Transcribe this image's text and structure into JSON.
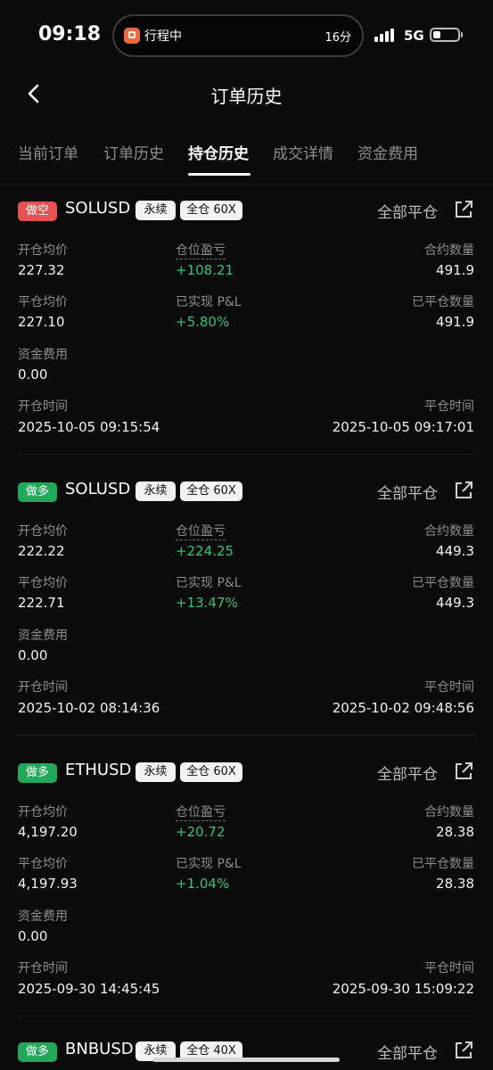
{
  "status_bar": {
    "time": "09:18",
    "live_activity": {
      "label": "行程中",
      "eta": "16分"
    },
    "network": "5G"
  },
  "header": {
    "title": "订单历史"
  },
  "tabs": [
    {
      "label": "当前订单"
    },
    {
      "label": "订单历史"
    },
    {
      "label": "持仓历史"
    },
    {
      "label": "成交详情"
    },
    {
      "label": "资金费用"
    }
  ],
  "active_tab": "持仓历史",
  "labels": {
    "close_all": "全部平仓",
    "avg_open_price": "开仓均价",
    "position_pnl": "仓位盈亏",
    "contract_qty": "合约数量",
    "avg_close_price": "平仓均价",
    "realized_pnl": "已实现 P&L",
    "closed_qty": "已平仓数量",
    "funding_fee": "资金费用",
    "open_time": "开仓时间",
    "close_time": "平仓时间"
  },
  "positions": [
    {
      "side": "做空",
      "symbol": "SOLUSD",
      "type": "永续",
      "margin": "全仓 60X",
      "avg_open_price": "227.32",
      "position_pnl": "+108.21",
      "contract_qty": "491.9",
      "avg_close_price": "227.10",
      "realized_pnl": "+5.80%",
      "closed_qty": "491.9",
      "funding_fee": "0.00",
      "open_time": "2025-10-05 09:15:54",
      "close_time": "2025-10-05 09:17:01"
    },
    {
      "side": "做多",
      "symbol": "SOLUSD",
      "type": "永续",
      "margin": "全仓 60X",
      "avg_open_price": "222.22",
      "position_pnl": "+224.25",
      "contract_qty": "449.3",
      "avg_close_price": "222.71",
      "realized_pnl": "+13.47%",
      "closed_qty": "449.3",
      "funding_fee": "0.00",
      "open_time": "2025-10-02 08:14:36",
      "close_time": "2025-10-02 09:48:56"
    },
    {
      "side": "做多",
      "symbol": "ETHUSD",
      "type": "永续",
      "margin": "全仓 60X",
      "avg_open_price": "4,197.20",
      "position_pnl": "+20.72",
      "contract_qty": "28.38",
      "avg_close_price": "4,197.93",
      "realized_pnl": "+1.04%",
      "closed_qty": "28.38",
      "funding_fee": "0.00",
      "open_time": "2025-09-30 14:45:45",
      "close_time": "2025-09-30 15:09:22"
    },
    {
      "side": "做多",
      "symbol": "BNBUSD",
      "type": "永续",
      "margin": "全仓 40X"
    }
  ],
  "colors": {
    "background": "#0b0b0b",
    "short_badge": "#e35353",
    "long_badge": "#22a85b",
    "profit_green": "#37c173",
    "muted_label": "#8d8d8d"
  }
}
